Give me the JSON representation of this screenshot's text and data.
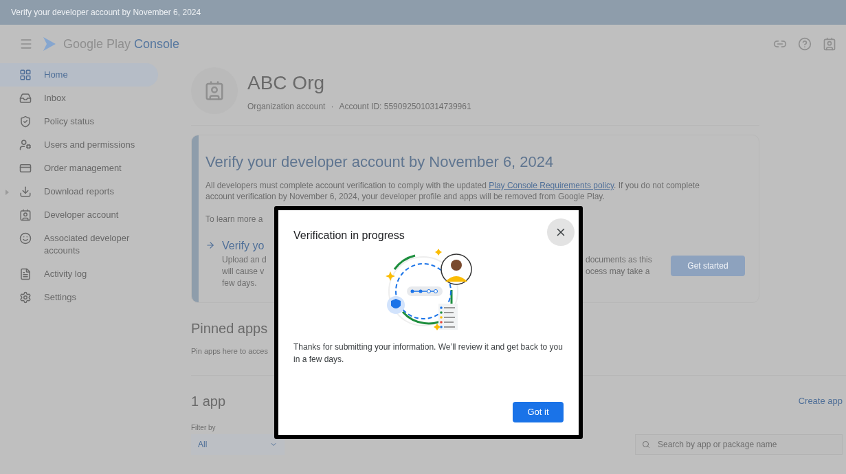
{
  "banner": {
    "text": "Verify your developer account by November 6, 2024"
  },
  "header": {
    "product_name": "Google Play",
    "product_suffix": "Console"
  },
  "sidebar": {
    "items": [
      {
        "label": "Home",
        "selected": true,
        "expandable": false
      },
      {
        "label": "Inbox",
        "selected": false,
        "expandable": false
      },
      {
        "label": "Policy status",
        "selected": false,
        "expandable": false
      },
      {
        "label": "Users and permissions",
        "selected": false,
        "expandable": false
      },
      {
        "label": "Order management",
        "selected": false,
        "expandable": false
      },
      {
        "label": "Download reports",
        "selected": false,
        "expandable": true
      },
      {
        "label": "Developer account",
        "selected": false,
        "expandable": false
      },
      {
        "label": "Associated developer accounts",
        "selected": false,
        "expandable": false
      },
      {
        "label": "Activity log",
        "selected": false,
        "expandable": false
      },
      {
        "label": "Settings",
        "selected": false,
        "expandable": false
      }
    ]
  },
  "account": {
    "name": "ABC Org",
    "type": "Organization account",
    "separator": "·",
    "account_id": "Account ID: 5590925010314739961"
  },
  "verify_card": {
    "title": "Verify your developer account by November 6, 2024",
    "text_before": "All developers must complete account verification to comply with the updated",
    "link": "Play Console Requirements policy",
    "text_after": ". If you do not complete account verification by November 6, 2024, your developer profile and apps will be removed from Google Play.",
    "learn_more": "To learn more a",
    "step_title": "Verify yo",
    "step_lines_left": [
      "Upload an d",
      "will cause v",
      "few days."
    ],
    "step_lines_right": [
      "documents as this",
      "ocess may take a"
    ],
    "button": "Get started"
  },
  "pinned": {
    "title": "Pinned apps",
    "subtitle": "Pin apps here to acces"
  },
  "apps": {
    "count": "1 app",
    "create": "Create app",
    "filter_label": "Filter by",
    "filter_value": "All",
    "search_placeholder": "Search by app or package name"
  },
  "dialog": {
    "title": "Verification in progress",
    "body": "Thanks for submitting your information. We’ll review it and get back to you in a few days.",
    "button": "Got it"
  }
}
